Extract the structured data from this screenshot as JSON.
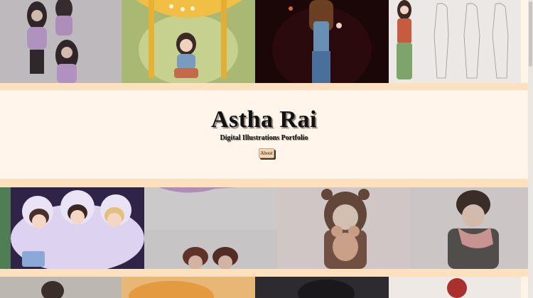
{
  "hero": {
    "title": "Astha Rai",
    "subtitle": "Digital Illustrations Portfolio",
    "about_label": "About"
  },
  "gallery": {
    "row1": [
      "illustration-two-girls-purple",
      "illustration-girl-under-umbrella",
      "illustration-girl-dark-background",
      "illustration-character-sheet"
    ],
    "row2": [
      "illustration-kids-in-blanket",
      "illustration-children-peeking",
      "illustration-child-with-teddy-bear",
      "illustration-boy-with-scarf"
    ],
    "row3": [
      "illustration-partial-1",
      "illustration-partial-2",
      "illustration-partial-3",
      "illustration-partial-4"
    ]
  },
  "colors": {
    "band": "#fde0bd",
    "hero_background": "#fff5ea",
    "button": "#f6d7b0"
  }
}
